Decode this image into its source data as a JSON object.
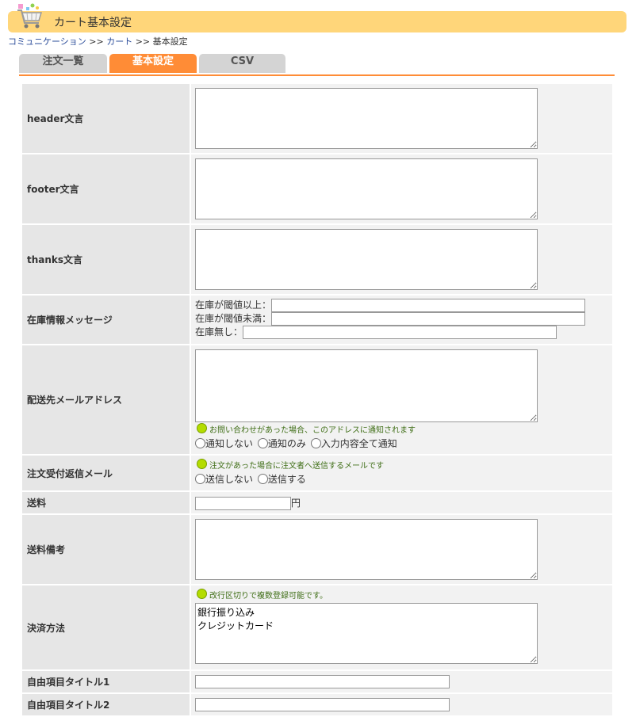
{
  "page": {
    "title": "カート基本設定"
  },
  "breadcrumb": {
    "item1": "コミュニケーション",
    "sep": ">>",
    "item2": "カート",
    "current": "基本設定"
  },
  "tabs": [
    {
      "label": "注文一覧"
    },
    {
      "label": "基本設定"
    },
    {
      "label": "CSV"
    }
  ],
  "fields": {
    "header": {
      "label": "header文言",
      "value": ""
    },
    "footer": {
      "label": "footer文言",
      "value": ""
    },
    "thanks": {
      "label": "thanks文言",
      "value": ""
    },
    "stock": {
      "label": "在庫情報メッセージ",
      "above_label": "在庫が閾値以上：",
      "below_label": "在庫が閾値未満：",
      "none_label": "在庫無し：",
      "above_value": "",
      "below_value": "",
      "none_value": ""
    },
    "delivery_email": {
      "label": "配送先メールアドレス",
      "value": "",
      "hint": "お問い合わせがあった場合、このアドレスに通知されます",
      "options": [
        "通知しない",
        "通知のみ",
        "入力内容全て通知"
      ]
    },
    "order_reply": {
      "label": "注文受付返信メール",
      "hint": "注文があった場合に注文者へ送信するメールです",
      "options": [
        "送信しない",
        "送信する"
      ]
    },
    "shipping": {
      "label": "送料",
      "value": "",
      "unit": "円"
    },
    "shipping_note": {
      "label": "送料備考",
      "value": ""
    },
    "payment": {
      "label": "決済方法",
      "hint": "改行区切りで複数登録可能です。",
      "value": "銀行振り込み\nクレジットカード"
    },
    "free1": {
      "label": "自由項目タイトル1",
      "value": ""
    },
    "free2": {
      "label": "自由項目タイトル2",
      "value": ""
    }
  }
}
